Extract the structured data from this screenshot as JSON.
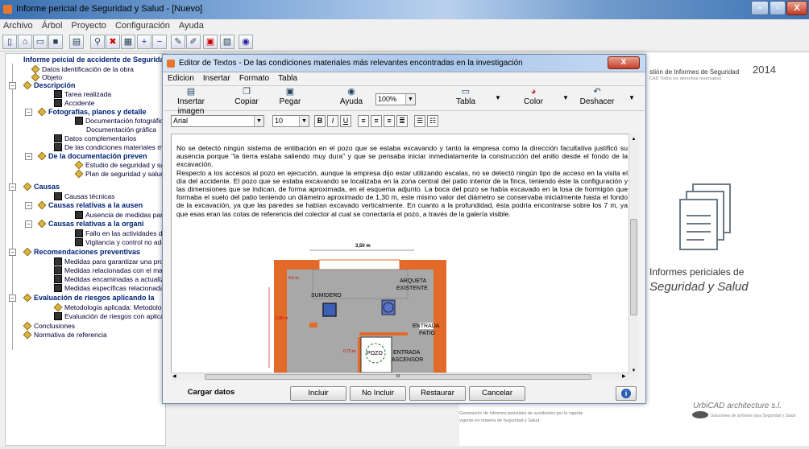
{
  "window": {
    "title": "Informe pericial de Seguridad y Salud - [Nuevo]"
  },
  "menubar": [
    "Archivo",
    "Árbol",
    "Proyecto",
    "Configuración",
    "Ayuda"
  ],
  "tree": {
    "root": "Informe peicial de accidente de Seguridad",
    "items": [
      "Datos identificación de la obra",
      "Objeto",
      "Descripción",
      "Tarea realizada",
      "Accidente",
      "Fotografías, planos y detalle",
      "Documentación fotográfica",
      "Documentación gráfica",
      "Datos complementarios",
      "De las condiciones materiales más",
      "De la documentación preven",
      "Estudio de seguridad y sa",
      "Plan de seguridad y salud",
      "Causas",
      "Causas técnicas",
      "Causas relativas a la ausen",
      "Ausencia de medidas para",
      "Causas relativas a la organi",
      "Fallo en las actividades de",
      "Vigilancia y control no ade",
      "Recomendaciones preventivas",
      "Medidas para garantizar una prote",
      "Medidas relacionadas con el mant",
      "Medidas encaminadas a actualiza",
      "Medidas específicas relacionadas",
      "Evaluación de riesgos aplicando la",
      "Metodología aplicada: Metodolog",
      "Evaluación de riesgos con aplicac",
      "Conclusiones",
      "Normativa de referencia"
    ]
  },
  "dialog": {
    "title": "Editor de Textos - De las condiciones materiales más relevantes encontradas en la investigación",
    "close": "X",
    "menu": [
      "Edicion",
      "Insertar",
      "Formato",
      "Tabla"
    ],
    "ribbon": {
      "insert_image": "Insertar imagen",
      "copy": "Copiar",
      "paste": "Pegar",
      "help": "Ayuda",
      "zoom": "100%",
      "table": "Tabla",
      "color": "Color",
      "undo": "Deshacer"
    },
    "format": {
      "font": "Arial",
      "size": "10",
      "bold": "B",
      "italic": "I",
      "underline": "U"
    },
    "paragraphs": [
      "No se detectó ningún sistema de entibación en el pozo que se estaba excavando y tanto la empresa como la dirección facultativa justificó su ausencia porque \"la tierra estaba saliendo muy dura\" y que se pensaba iniciar inmediatamente la construcción del anillo desde el fondo de la excavación.",
      "Respecto a los accesos al pozo en ejecución, aunque la empresa dijo estar utilizando escalas, no se detectó ningún tipo de acceso en la visita el día del accidente. El pozo que se estaba excavando se localizaba en la zona central del patio interior de la finca, teniendo éste la configuración y las dimensiones que se indican, de forma aproximada, en el esquema adjunto. La boca del pozo se había excavado en la losa de hormigón que formaba el suelo del patio teniendo un diámetro aproximado de 1,30 m, este mismo valor del diámetro se conservaba inicialmente hasta el fondo de la excavación, ya que las paredes se habían excavado verticalmente. En cuanto a la profundidad, ésta podría encontrarse sobre los 7 m, ya que esas eran las cotas de referencia del colector al cual se conectaría el pozo, a través de la galería visible."
    ],
    "plan": {
      "width": "3,50 m",
      "h1": "0.5 m",
      "left": "2,90 m",
      "h2": "0,75 m",
      "sumidero": "SUMIDERO",
      "arqueta1": "ARQUETA",
      "arqueta2": "EXISTENTE",
      "pozo": "POZO",
      "entrada_patio1": "ENTRADA",
      "entrada_patio2": "PATIO",
      "entrada_asc1": "ENTRADA",
      "entrada_asc2": "ASCENSOR"
    },
    "scroll_mark": "III",
    "buttons": {
      "load": "Cargar datos",
      "include": "Incluir",
      "exclude": "No Incluir",
      "restore": "Restaurar",
      "cancel": "Cancelar",
      "info": "i"
    }
  },
  "right_panel": {
    "header_left": "stión de Informes de Seguridad",
    "year": "2014",
    "header_sub": "CAD  Todos los derechos reservados",
    "brand1": "Informes periciales de",
    "brand2": "Seguridad y Salud",
    "footer1": "Generación de informes periciales de accidentes por la vigente",
    "footer2": "vigente en materia de Seguridad y Salud.",
    "urbicad": "UrbiCAD architecture s.l.",
    "urbicad_sub": "Soluciones de software para Seguridad y Salud"
  },
  "colors": {
    "accent": "#1f3fa0",
    "wall": "#e36b2a",
    "floor": "#9a9a9a"
  }
}
